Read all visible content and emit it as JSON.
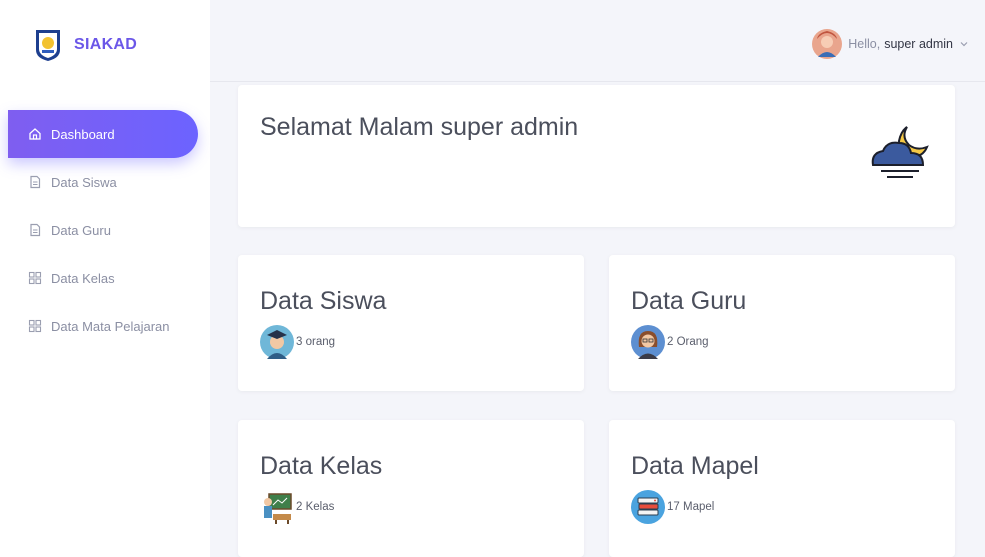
{
  "brand": {
    "name": "SIAKAD",
    "logo_icon": "school-emblem-icon"
  },
  "sidebar": {
    "items": [
      {
        "label": "Dashboard",
        "icon": "home-icon",
        "active": true
      },
      {
        "label": "Data Siswa",
        "icon": "document-icon",
        "active": false
      },
      {
        "label": "Data Guru",
        "icon": "document-icon",
        "active": false
      },
      {
        "label": "Data Kelas",
        "icon": "grid-icon",
        "active": false
      },
      {
        "label": "Data Mata Pelajaran",
        "icon": "grid-icon",
        "active": false
      }
    ]
  },
  "topbar": {
    "hello": "Hello,",
    "username": "super admin",
    "avatar_icon": "user-avatar-icon"
  },
  "greeting": {
    "title": "Selamat Malam super admin",
    "icon": "moon-cloud-icon"
  },
  "stats": [
    {
      "title": "Data Siswa",
      "value": "3 orang",
      "icon": "student-icon"
    },
    {
      "title": "Data Guru",
      "value": "2 Orang",
      "icon": "teacher-icon"
    },
    {
      "title": "Data Kelas",
      "value": "2 Kelas",
      "icon": "classroom-icon"
    },
    {
      "title": "Data Mapel",
      "value": "17 Mapel",
      "icon": "books-icon"
    }
  ],
  "colors": {
    "accent": "#6c63ff",
    "background": "#f4f5fa"
  }
}
